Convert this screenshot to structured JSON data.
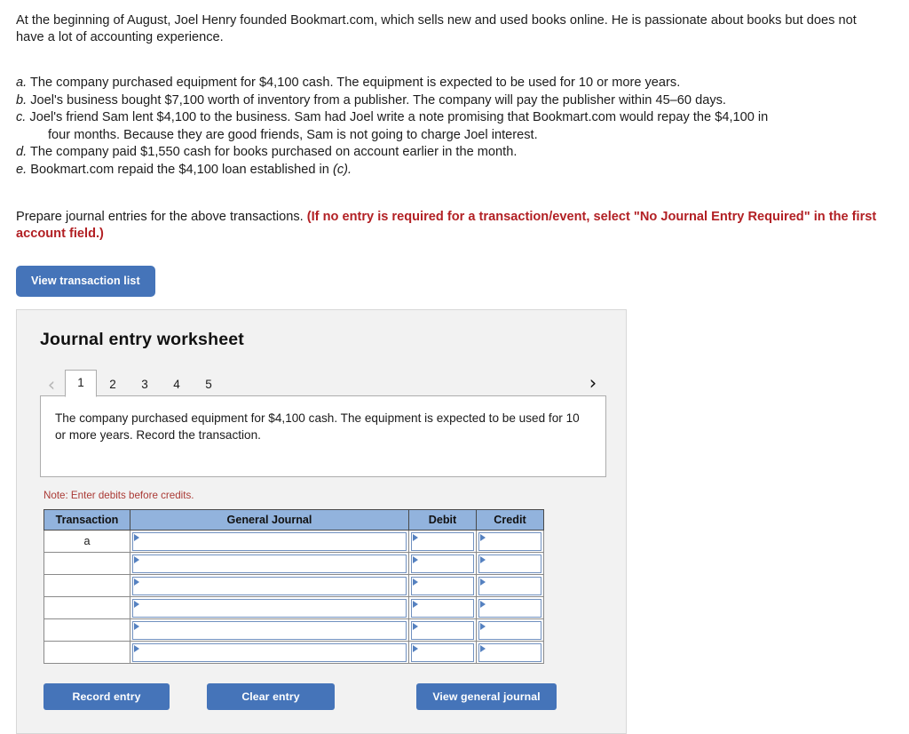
{
  "intro": "At the beginning of August, Joel Henry founded Bookmart.com, which sells new and used books online. He is passionate about books but does not have a lot of accounting experience.",
  "transactions": [
    {
      "label": "a.",
      "text": "The company purchased equipment for $4,100 cash. The equipment is expected to be used for 10 or more years."
    },
    {
      "label": "b.",
      "text": "Joel's business bought $7,100 worth of inventory from a publisher. The company will pay the publisher within 45–60 days."
    },
    {
      "label": "c.",
      "text": "Joel's friend Sam lent $4,100 to the business. Sam had Joel write a note promising that Bookmart.com would repay the $4,100 in",
      "continuation": "four months. Because they are good friends, Sam is not going to charge Joel interest."
    },
    {
      "label": "d.",
      "text": "The company paid $1,550 cash for books purchased on account earlier in the month."
    },
    {
      "label": "e.",
      "text": "Bookmart.com repaid the $4,100 loan established in ",
      "italic_suffix": "(c)."
    }
  ],
  "prepare": {
    "plain": "Prepare journal entries for the above transactions. ",
    "emphasis": "(If no entry is required for a transaction/event, select \"No Journal Entry Required\" in the first account field.)"
  },
  "view_transaction_list_label": "View transaction list",
  "worksheet": {
    "title": "Journal entry worksheet",
    "prev_icon": "chevron-left-icon",
    "next_icon": "chevron-right-icon",
    "prev_glyph": "‹",
    "next_glyph": "›",
    "tabs": [
      {
        "label": "1",
        "active": true
      },
      {
        "label": "2",
        "active": false
      },
      {
        "label": "3",
        "active": false
      },
      {
        "label": "4",
        "active": false
      },
      {
        "label": "5",
        "active": false
      }
    ],
    "description": "The company purchased equipment for $4,100 cash. The equipment is expected to be used for 10 or more years. Record the transaction.",
    "note": "Note: Enter debits before credits.",
    "table": {
      "headers": [
        "Transaction",
        "General Journal",
        "Debit",
        "Credit"
      ],
      "rows": [
        {
          "transaction": "a",
          "general_journal": "",
          "debit": "",
          "credit": ""
        },
        {
          "transaction": "",
          "general_journal": "",
          "debit": "",
          "credit": ""
        },
        {
          "transaction": "",
          "general_journal": "",
          "debit": "",
          "credit": ""
        },
        {
          "transaction": "",
          "general_journal": "",
          "debit": "",
          "credit": ""
        },
        {
          "transaction": "",
          "general_journal": "",
          "debit": "",
          "credit": ""
        },
        {
          "transaction": "",
          "general_journal": "",
          "debit": "",
          "credit": ""
        }
      ]
    },
    "buttons": {
      "record": "Record entry",
      "clear": "Clear entry",
      "view_general_journal": "View general journal"
    }
  },
  "colors": {
    "button_blue": "#4574b9",
    "table_header_blue": "#92b3dd",
    "note_red": "#aa3a35",
    "emphasis_red": "#b22024",
    "panel_bg": "#f2f2f2"
  }
}
